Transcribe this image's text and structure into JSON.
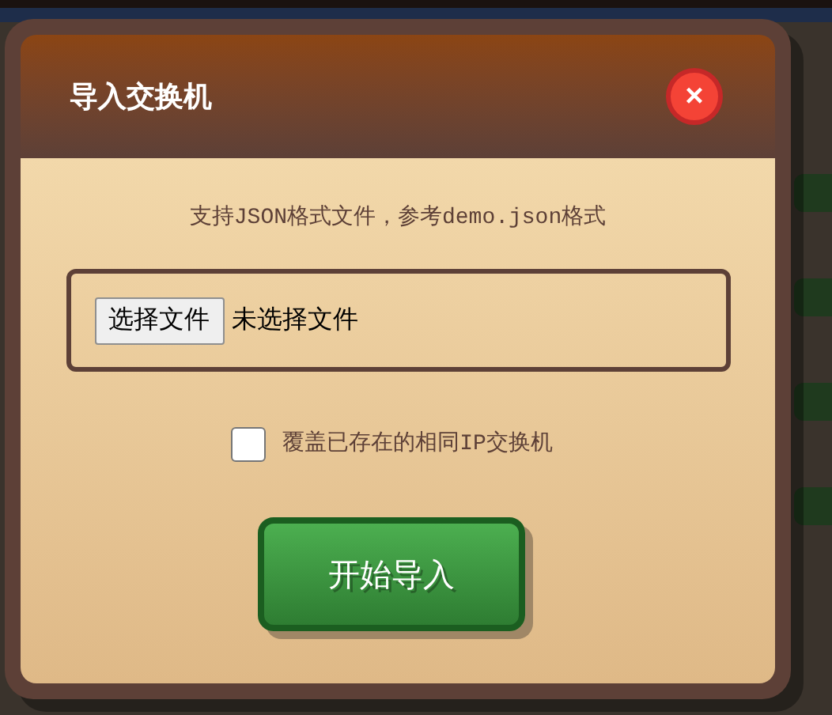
{
  "dialog": {
    "title": "导入交换机",
    "close": "×",
    "hint": "支持JSON格式文件，参考demo.json格式",
    "file_input": {
      "button": "选择文件",
      "status": "未选择文件"
    },
    "overwrite": {
      "label": "覆盖已存在的相同IP交换机",
      "checked": false
    },
    "submit": "开始导入"
  }
}
